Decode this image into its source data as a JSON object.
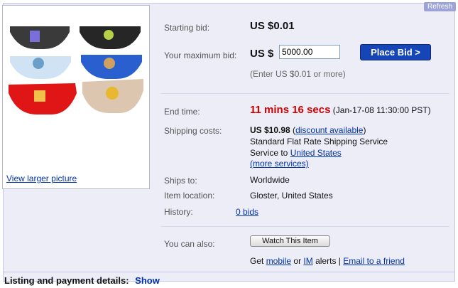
{
  "refresh_label": "Refresh",
  "photo": {
    "view_larger": "View larger picture"
  },
  "bid": {
    "starting_label": "Starting bid:",
    "starting_value": "US $0.01",
    "max_label": "Your maximum bid:",
    "currency": "US $",
    "max_value": "5000.00",
    "place_bid": "Place Bid >",
    "hint": "(Enter US $0.01 or more)"
  },
  "details": {
    "end_label": "End time:",
    "end_remaining": "11 mins 16 secs",
    "end_date": "(Jan-17-08 11:30:00 PST)",
    "shipping_label": "Shipping costs:",
    "shipping_cost": "US $10.98",
    "discount_link": "discount available",
    "shipping_service": "Standard Flat Rate Shipping Service",
    "service_to": "Service to",
    "service_to_link": "United States",
    "more_services": "(more services)",
    "ships_to_label": "Ships to:",
    "ships_to_value": "Worldwide",
    "location_label": "Item location:",
    "location_value": "Gloster, United States",
    "history_label": "History:",
    "history_link": "0 bids"
  },
  "also": {
    "label": "You can also:",
    "watch_button": "Watch This Item",
    "get": "Get",
    "mobile_link": "mobile",
    "or": "or",
    "im_link": "IM",
    "alerts": "alerts |",
    "email_link": "Email to a friend"
  },
  "listing": {
    "label": "Listing and payment details:",
    "show_link": "Show"
  }
}
